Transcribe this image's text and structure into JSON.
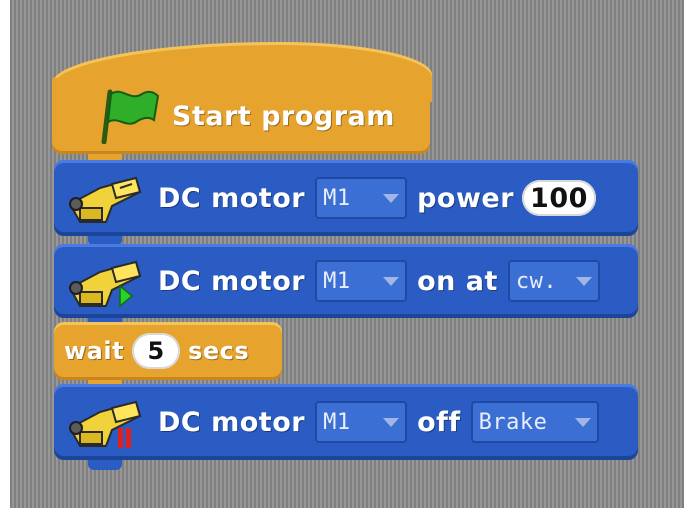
{
  "hat": {
    "label": "Start program",
    "icon": "green-flag-icon"
  },
  "blocks": {
    "power": {
      "label": "DC motor",
      "motor": "M1",
      "action": "power",
      "value": "100"
    },
    "on": {
      "label": "DC motor",
      "motor": "M1",
      "action": "on at",
      "direction": "cw."
    },
    "wait": {
      "prefix": "wait",
      "value": "5",
      "suffix": "secs"
    },
    "off": {
      "label": "DC motor",
      "motor": "M1",
      "action": "off",
      "mode": "Brake"
    }
  },
  "colors": {
    "control": "#e6a32e",
    "motion": "#2a5cc4",
    "background": "#8c8c8c"
  }
}
